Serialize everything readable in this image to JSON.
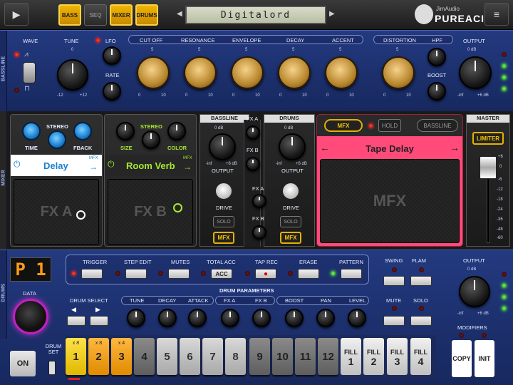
{
  "topbar": {
    "tabs": [
      "BASS",
      "SEQ",
      "MIXER",
      "DRUMS"
    ],
    "pattern_name": "Digitalord",
    "logo_top": "JimAudio",
    "logo_bottom": "PUREACID"
  },
  "bassline": {
    "side_label": "BASSLINE",
    "labels": {
      "wave": "WAVE",
      "tune": "TUNE",
      "lfo": "LFO",
      "rate": "RATE",
      "cutoff": "CUT OFF",
      "resonance": "RESONANCE",
      "envelope": "ENVELOPE",
      "decay": "DECAY",
      "accent": "ACCENT",
      "distortion": "DISTORTION",
      "hpf": "HPF",
      "boost": "BOOST",
      "output": "OUTPUT"
    },
    "tune_scale": [
      "0",
      "-12",
      "+12"
    ],
    "knob_scale": [
      "5",
      "0",
      "10"
    ],
    "output_scale": [
      "0 dB",
      "-inf",
      "+6 dB"
    ]
  },
  "mixer": {
    "side_label": "MIXER",
    "fx_a": {
      "knobs": [
        "TIME",
        "STEREO",
        "FBACK"
      ],
      "name": "Delay",
      "tag": "MFX",
      "pad": "FX A"
    },
    "fx_b": {
      "knobs": [
        "SIZE",
        "STEREO",
        "COLOR"
      ],
      "name": "Room Verb",
      "tag": "MFX",
      "pad": "FX B"
    },
    "bass_ch": {
      "title": "BASSLINE",
      "fx_a": "FX A",
      "fx_b": "FX B",
      "scale": [
        "0 dB",
        "-inf",
        "+6 dB"
      ],
      "output": "OUTPUT",
      "drive": "DRIVE",
      "solo": "SOLO",
      "mfx": "MFX"
    },
    "drum_ch": {
      "title": "DRUMS",
      "fx_a": "FX A",
      "fx_b": "FX B",
      "scale": [
        "0 dB",
        "-inf",
        "+6 dB"
      ],
      "output": "OUTPUT",
      "drive": "DRIVE",
      "solo": "SOLO",
      "mfx": "MFX"
    },
    "mfx": {
      "mfx_btn": "MFX",
      "hold_btn": "HOLD",
      "bassline_btn": "BASSLINE",
      "effect_name": "Tape Delay",
      "pad": "MFX"
    },
    "master": {
      "title": "MASTER",
      "limiter": "LIMITER",
      "scale": [
        "+6",
        "0",
        "-6",
        "-12",
        "-18",
        "-24",
        "-36",
        "-48",
        "-60"
      ]
    }
  },
  "drums": {
    "side_label": "DRUMS",
    "pattern_display": "P 1",
    "data_label": "DATA",
    "controls": {
      "trigger": "TRIGGER",
      "step_edit": "STEP EDIT",
      "mutes": "MUTES",
      "total_acc": "TOTAL ACC",
      "acc_btn": "ACC",
      "tap_rec": "TAP REC",
      "erase": "ERASE",
      "pattern": "PATTERN",
      "swing": "SWING",
      "flam": "FLAM",
      "output": "OUTPUT"
    },
    "output_scale": [
      "0 dB",
      "-inf",
      "+6 dB"
    ],
    "params_title": "DRUM PARAMETERS",
    "params": {
      "drum_select": "DRUM  SELECT",
      "tune": "TUNE",
      "decay": "DECAY",
      "attack": "ATTACK",
      "fx_a": "FX A",
      "fx_b": "FX B",
      "boost": "BOOST",
      "pan": "PAN",
      "level": "LEVEL",
      "mute": "MUTE",
      "solo": "SOLO"
    },
    "modifiers": "MODIFIERS",
    "copy": "COPY",
    "init": "INIT",
    "on": "ON",
    "drum_set": "DRUM SET",
    "steps": [
      {
        "n": "1",
        "sub": "x 8"
      },
      {
        "n": "2",
        "sub": "x 8"
      },
      {
        "n": "3",
        "sub": "x 4"
      },
      {
        "n": "4",
        "sub": ""
      },
      {
        "n": "5",
        "sub": ""
      },
      {
        "n": "6",
        "sub": ""
      },
      {
        "n": "7",
        "sub": ""
      },
      {
        "n": "8",
        "sub": ""
      },
      {
        "n": "9",
        "sub": ""
      },
      {
        "n": "10",
        "sub": ""
      },
      {
        "n": "11",
        "sub": ""
      },
      {
        "n": "12",
        "sub": ""
      }
    ],
    "fills": [
      {
        "t": "FILL",
        "n": "1"
      },
      {
        "t": "FILL",
        "n": "2"
      },
      {
        "t": "FILL",
        "n": "3"
      },
      {
        "t": "FILL",
        "n": "4"
      }
    ]
  },
  "colors": {
    "accent_yellow": "#f0b400",
    "mfx_pink": "#ff4a7a",
    "panel_blue": "#1d3070",
    "led_red": "#ff3030"
  }
}
